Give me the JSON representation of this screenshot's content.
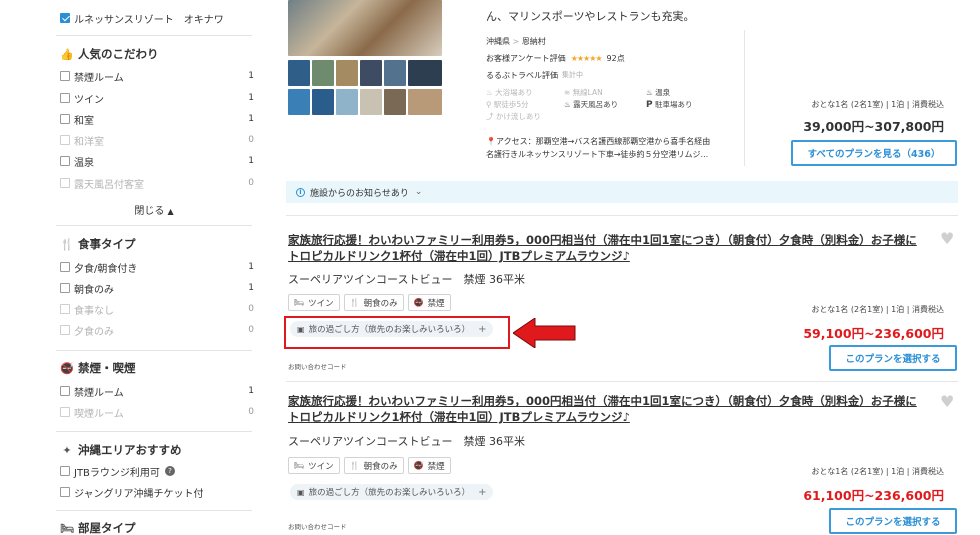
{
  "sidebar": {
    "top_checked": "ルネッサンスリゾート　オキナワ",
    "sections": [
      {
        "title": "人気のこだわり",
        "icon": "thumbs-up-icon",
        "items": [
          {
            "label": "禁煙ルーム",
            "count": "1",
            "disabled": false
          },
          {
            "label": "ツイン",
            "count": "1",
            "disabled": false
          },
          {
            "label": "和室",
            "count": "1",
            "disabled": false
          },
          {
            "label": "和洋室",
            "count": "0",
            "disabled": true
          },
          {
            "label": "温泉",
            "count": "1",
            "disabled": false
          },
          {
            "label": "露天風呂付客室",
            "count": "0",
            "disabled": true
          }
        ],
        "collapse_label": "閉じる"
      },
      {
        "title": "食事タイプ",
        "icon": "fork-knife-icon",
        "items": [
          {
            "label": "夕食/朝食付き",
            "count": "1",
            "disabled": false
          },
          {
            "label": "朝食のみ",
            "count": "1",
            "disabled": false
          },
          {
            "label": "食事なし",
            "count": "0",
            "disabled": true
          },
          {
            "label": "夕食のみ",
            "count": "0",
            "disabled": true
          }
        ]
      },
      {
        "title": "禁煙・喫煙",
        "icon": "no-smoking-icon",
        "items": [
          {
            "label": "禁煙ルーム",
            "count": "1",
            "disabled": false
          },
          {
            "label": "喫煙ルーム",
            "count": "0",
            "disabled": true
          }
        ]
      },
      {
        "title": "沖縄エリアおすすめ",
        "icon": "sparkle-icon",
        "items": [
          {
            "label": "JTBラウンジ利用可",
            "count": "",
            "disabled": false,
            "help": "?"
          },
          {
            "label": "ジャングリア沖縄チケット付",
            "count": "",
            "disabled": false
          }
        ]
      },
      {
        "title": "部屋タイプ",
        "icon": "bed-icon"
      }
    ]
  },
  "hotel": {
    "intro_tail": "ん、マリンスポーツやレストランも充実。",
    "breadcrumb_pref": "沖縄県",
    "breadcrumb_sep": ">",
    "breadcrumb_town": "恩納村",
    "survey_label": "お客様アンケート評価",
    "stars": "★★★★★",
    "score": "92点",
    "rurubu_label": "るるぶトラベル評価",
    "rurubu_value": "集計中",
    "amenities": [
      {
        "label": "大浴場あり",
        "icon": "bath-icon",
        "active": false
      },
      {
        "label": "無線LAN",
        "icon": "wifi-icon",
        "active": false
      },
      {
        "label": "温泉",
        "icon": "onsen-icon",
        "active": true
      },
      {
        "label": "駅徒歩5分",
        "icon": "walk-icon",
        "active": false
      },
      {
        "label": "露天風呂あり",
        "icon": "outdoor-bath-icon",
        "active": true
      },
      {
        "label": "駐車場あり",
        "icon": "parking-icon",
        "active": true
      },
      {
        "label": "かけ流しあり",
        "icon": "flow-icon",
        "active": false
      }
    ],
    "access_prefix": "アクセス：",
    "access_line1": "那覇空港→バス名護西線那覇空港から喜手名経由",
    "access_line2": "名護行きルネッサンスリゾート下車→徒歩約５分空港リムジ...",
    "guest_info": "おとな1名 (2名1室) | 1泊 | 消費税込",
    "price_range": "39,000円~307,800円",
    "all_plans_button": "すべてのプランを見る（436）",
    "notice": "施設からのお知らせあり"
  },
  "plans": [
    {
      "title": "家族旅行応援！わいわいファミリー利用券5，000円相当付（滞在中1回1室につき）（朝食付）夕食時（別料金）お子様にトロピカルドリンク1杯付（滞在中1回）JTBプレミアムラウンジ♪",
      "room": "スーペリアツインコーストビュー　禁煙 36平米",
      "chips": [
        {
          "label": "ツイン",
          "icon": "bed-icon"
        },
        {
          "label": "朝食のみ",
          "icon": "fork-knife-icon"
        },
        {
          "label": "禁煙",
          "icon": "no-smoking-icon"
        }
      ],
      "travel_tag": "旅の過ごし方（旅先のお楽しみいろいろ）",
      "inquiry": "お問い合わせコード",
      "guest_info": "おとな1名 (2名1室) | 1泊 | 消費税込",
      "price": "59,100円~236,600円",
      "select_button": "このプランを選択する"
    },
    {
      "title": "家族旅行応援！わいわいファミリー利用券5，000円相当付（滞在中1回1室につき）（朝食付）夕食時（別料金）お子様にトロピカルドリンク1杯付（滞在中1回）JTBプレミアムラウンジ♪",
      "room": "スーペリアツインコーストビュー　禁煙 36平米",
      "chips": [
        {
          "label": "ツイン",
          "icon": "bed-icon"
        },
        {
          "label": "朝食のみ",
          "icon": "fork-knife-icon"
        },
        {
          "label": "禁煙",
          "icon": "no-smoking-icon"
        }
      ],
      "travel_tag": "旅の過ごし方（旅先のお楽しみいろいろ）",
      "inquiry": "お問い合わせコード",
      "guest_info": "おとな1名 (2名1室) | 1泊 | 消費税込",
      "price": "61,100円~236,600円",
      "select_button": "このプランを選択する"
    }
  ],
  "colors": {
    "accent_blue": "#2b8fd6",
    "price_red": "#e0191d",
    "annotation_red": "#e0191d"
  }
}
